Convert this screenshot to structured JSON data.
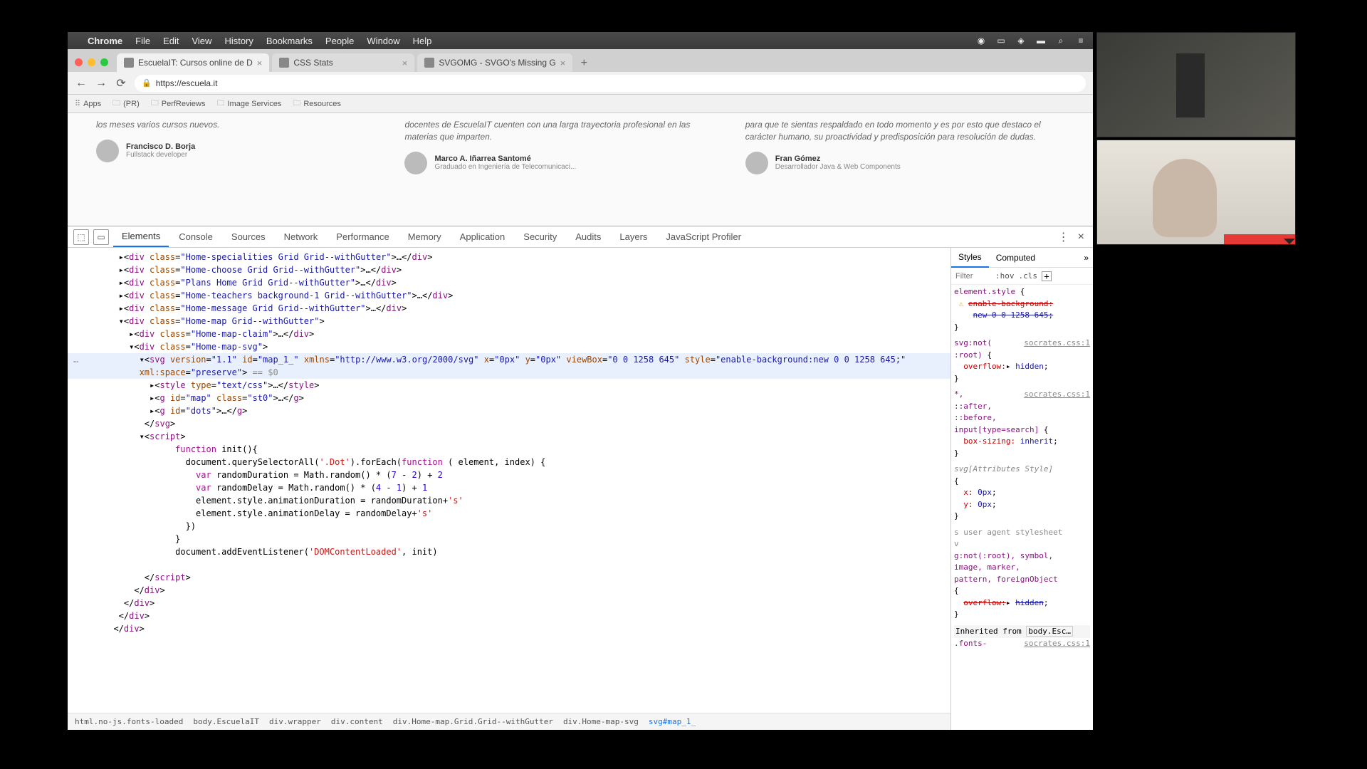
{
  "menubar": {
    "app": "Chrome",
    "items": [
      "File",
      "Edit",
      "View",
      "History",
      "Bookmarks",
      "People",
      "Window",
      "Help"
    ]
  },
  "tabs": [
    {
      "title": "EscuelaIT: Cursos online de D"
    },
    {
      "title": "CSS Stats"
    },
    {
      "title": "SVGOMG - SVGO's Missing G"
    }
  ],
  "url": "https://escuela.it",
  "bookmarks": [
    "Apps",
    "(PR)",
    "PerfReviews",
    "Image Services",
    "Resources"
  ],
  "page": {
    "col1": {
      "text": "los meses varios cursos nuevos.",
      "author": "Francisco D. Borja",
      "role": "Fullstack developer"
    },
    "col2": {
      "text": "docentes de EscuelaIT cuenten con una larga trayectoria profesional en las materias que imparten.",
      "author": "Marco A. Iñarrea Santomé",
      "role": "Graduado en Ingeniería de Telecomunicaci..."
    },
    "col3": {
      "text": "para que te sientas respaldado en todo momento y es por esto que destaco el carácter humano, su proactividad y predisposición para resolución de dudas.",
      "author": "Fran Gómez",
      "role": "Desarrollador Java & Web Components"
    }
  },
  "devtools": {
    "tabs": [
      "Elements",
      "Console",
      "Sources",
      "Network",
      "Performance",
      "Memory",
      "Application",
      "Security",
      "Audits",
      "Layers",
      "JavaScript Profiler"
    ],
    "activeTab": "Elements",
    "breadcrumb": [
      "html.no-js.fonts-loaded",
      "body.EscuelaIT",
      "div.wrapper",
      "div.content",
      "div.Home-map.Grid.Grid--withGutter",
      "div.Home-map-svg",
      "svg#map_1_"
    ],
    "styles": {
      "tabs": [
        "Styles",
        "Computed"
      ],
      "filter": "Filter",
      "hov": ":hov",
      "cls": ".cls"
    }
  }
}
